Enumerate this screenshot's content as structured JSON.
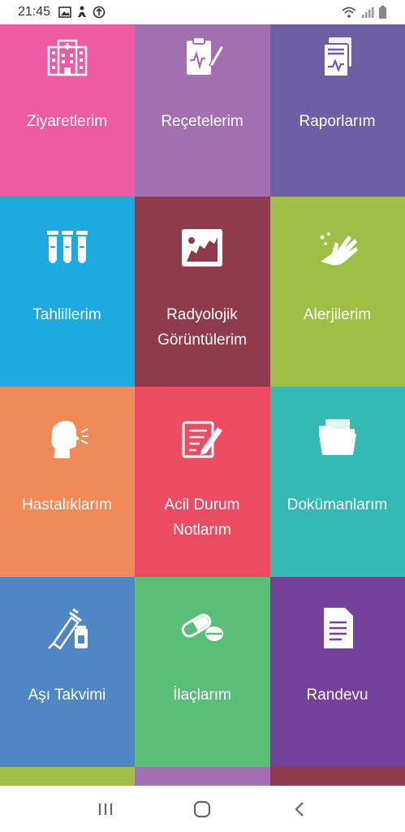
{
  "status_bar": {
    "time": "21:45",
    "icons_left": [
      "image-icon",
      "accessibility-icon",
      "data-saver-icon"
    ],
    "icons_right": [
      "wifi-icon",
      "signal-icon",
      "battery-icon"
    ]
  },
  "tiles": [
    {
      "label": "Ziyaretlerim",
      "color": "#F05AA4",
      "icon": "hospital-icon"
    },
    {
      "label": "Reçetelerim",
      "color": "#A36FB3",
      "icon": "prescription-clipboard-icon"
    },
    {
      "label": "Raporlarım",
      "color": "#6C5FA6",
      "icon": "report-icon"
    },
    {
      "label": "Tahlillerim",
      "color": "#1CAAE0",
      "icon": "test-tubes-icon"
    },
    {
      "label": "Radyolojik\nGörüntülerim",
      "color": "#8F3B4C",
      "icon": "xray-icon"
    },
    {
      "label": "Alerjilerim",
      "color": "#9FBE45",
      "icon": "allergy-hand-icon"
    },
    {
      "label": "Hastalıklarım",
      "color": "#F08A57",
      "icon": "cough-icon"
    },
    {
      "label": "Acil Durum\nNotlarım",
      "color": "#EC4C62",
      "icon": "notes-pencil-icon"
    },
    {
      "label": "Dokümanlarım",
      "color": "#34B9B5",
      "icon": "folder-icon"
    },
    {
      "label": "Aşı Takvimi",
      "color": "#4F86C4",
      "icon": "vaccine-icon"
    },
    {
      "label": "İlaçlarım",
      "color": "#5BBE78",
      "icon": "pills-icon"
    },
    {
      "label": "Randevu",
      "color": "#74419C",
      "icon": "document-icon"
    }
  ],
  "next_row_colors": [
    "#9FBE45",
    "#A36FB3",
    "#8F3B4C"
  ],
  "nav": {
    "recents": "recent-apps-icon",
    "home": "home-icon",
    "back": "back-icon"
  }
}
